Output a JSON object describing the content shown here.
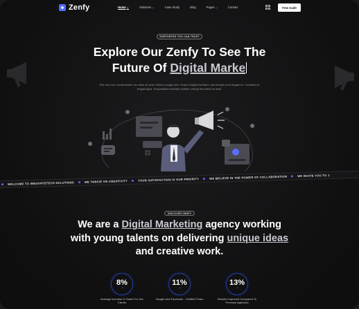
{
  "header": {
    "brand": "Zenfy",
    "nav": [
      {
        "label": "Home",
        "caret": true
      },
      {
        "label": "Solutions",
        "caret": true
      },
      {
        "label": "Case Study",
        "caret": false
      },
      {
        "label": "Blog",
        "caret": false
      },
      {
        "label": "Pages",
        "caret": true
      },
      {
        "label": "Contact",
        "caret": false
      }
    ],
    "cta": "Free Audit"
  },
  "hero": {
    "badge": "SUPPORTED YOU CAN TRUST",
    "title_line1": "Explore Our Zenfy To See The",
    "title_line2_prefix": "Future Of ",
    "title_line2_highlight": "Digital Marke",
    "subtitle_line1": "Sed nisl eros, condimentum nec diam sit amet, finibus congue sem. Fusce fringilla est libero, sed tempus urna feugiat eu. Curabitur eu",
    "subtitle_line2": "feugiat ligula. Suspendisse molestie porttitor velit go this week for work."
  },
  "ticker": [
    "WELCOME TO INNOVATETECH SOLUTIONS",
    "WE THRIVE ON CREATIVITY",
    "YOUR SATISFACTION IS OUR PRIORITY",
    "WE BELIEVE IN THE POWER OF COLLABORATION",
    "WE INVITE YOU TO J"
  ],
  "about": {
    "badge": "DISCOVER ZENFY",
    "line1_prefix": "We are a ",
    "line1_highlight": "Digital Marketing",
    "line1_suffix": " agency working",
    "line2_prefix": "with young talents on delivering ",
    "line2_highlight": "unique ideas",
    "line3": "and creative work."
  },
  "stats": [
    {
      "value": "8%",
      "label": "Average Increase In Sales For Our Clients"
    },
    {
      "value": "11%",
      "label": "Google And Facebook - Certified Team"
    },
    {
      "value": "13%",
      "label": "Results Improved Compared To Previous Agencies"
    }
  ],
  "stat_arrow": "↗",
  "colors": {
    "accent": "#4f6bff",
    "background": "#101011"
  }
}
